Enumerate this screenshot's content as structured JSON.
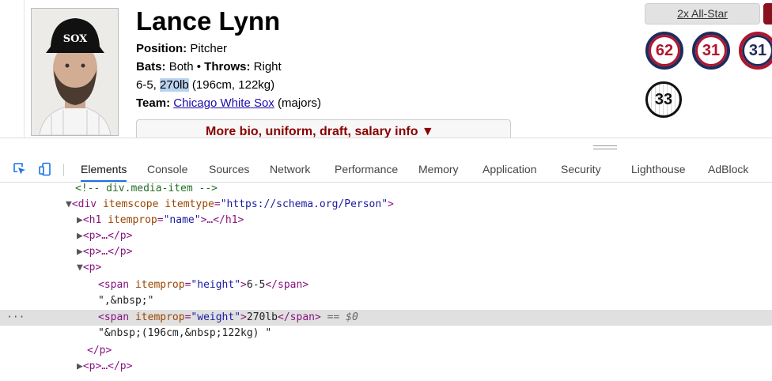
{
  "player": {
    "name": "Lance Lynn",
    "position_label": "Position:",
    "position": "Pitcher",
    "bats_label": "Bats:",
    "bats": "Both",
    "bullet": "•",
    "throws_label": "Throws:",
    "throws": "Right",
    "height": "6-5,",
    "weight": "270lb",
    "metric": "(196cm, 122kg)",
    "team_label": "Team:",
    "team": "Chicago White Sox",
    "team_suffix": "(majors)",
    "more_link": "More bio, uniform, draft, salary info ▼"
  },
  "awards": {
    "allstar": "2x All-Star"
  },
  "uniform_numbers": [
    "62",
    "31",
    "31",
    "33"
  ],
  "devtools": {
    "tabs": [
      "Elements",
      "Console",
      "Sources",
      "Network",
      "Performance",
      "Memory",
      "Application",
      "Security",
      "Lighthouse",
      "AdBlock"
    ],
    "active_tab": "Elements",
    "dots": "···",
    "lines": {
      "comment": "<!-- div.media-item -->",
      "div_open_tag": "<div",
      "div_attr1": "itemscope",
      "div_attr2": "itemtype",
      "div_attr2_val": "\"https://schema.org/Person\"",
      "div_close": ">",
      "h1_open": "<h1",
      "h1_attr": "itemprop",
      "h1_attr_val": "\"name\"",
      "h1_rest": ">…</h1>",
      "p_collapsed": "<p>…</p>",
      "p_open": "<p>",
      "span_open": "<span",
      "span_attr": "itemprop",
      "height_val": "\"height\"",
      "height_text": "6-5",
      "span_close": "</span>",
      "text_nbsp": "\",&nbsp;\"",
      "weight_val": "\"weight\"",
      "weight_text": "270lb",
      "selected_marker": "== $0",
      "text_metric": "\"&nbsp;(196cm,&nbsp;122kg) \"",
      "p_close": "</p>",
      "eq": "=",
      "gt": ">",
      "lt_slash": "</span>"
    }
  }
}
